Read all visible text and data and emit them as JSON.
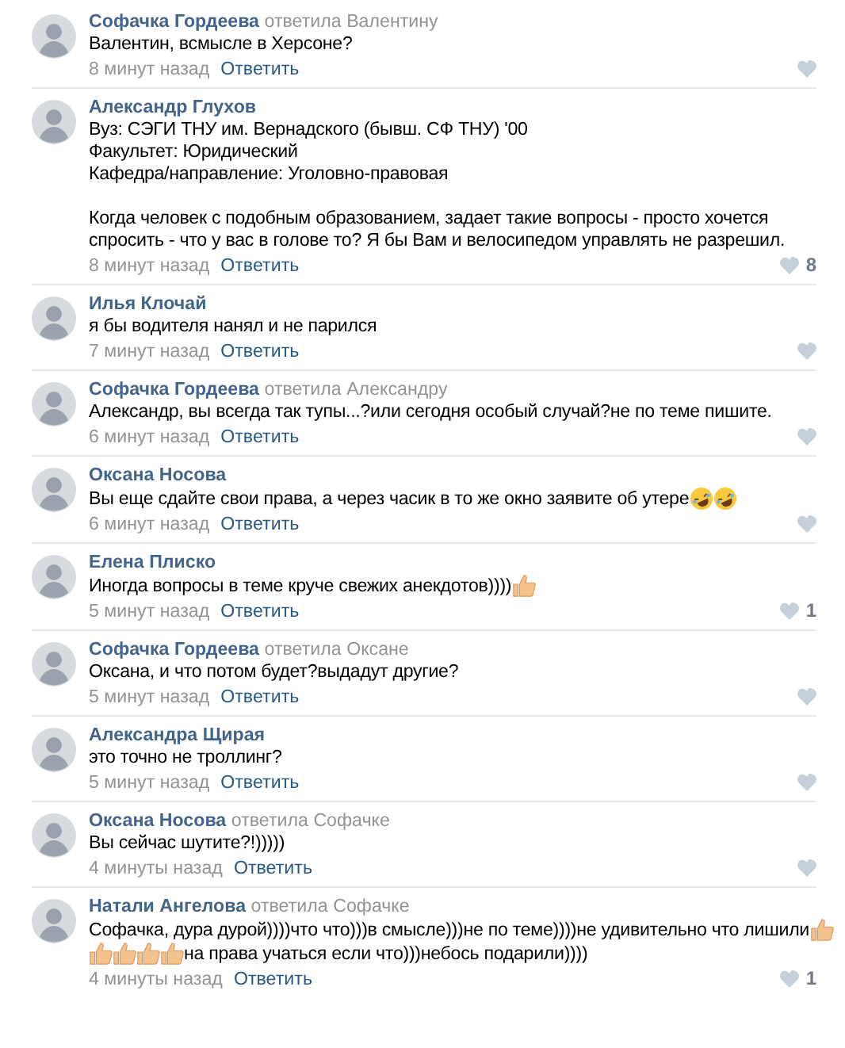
{
  "comments": [
    {
      "author": "Софачка Гордеева",
      "reply_to": "ответила Валентину",
      "paragraphs": [
        [
          [
            {
              "kind": "text",
              "text": "Валентин, всмысле в Херсоне?"
            }
          ]
        ]
      ],
      "time": "8 минут назад",
      "reply": "Ответить"
    },
    {
      "author": "Александр Глухов",
      "paragraphs": [
        [
          [
            {
              "kind": "text",
              "text": "Вуз: СЭГИ ТНУ им. Вернадского (бывш. СФ ТНУ) '00"
            }
          ],
          [
            {
              "kind": "text",
              "text": "Факультет: Юридический"
            }
          ],
          [
            {
              "kind": "text",
              "text": "Кафедра/направление: Уголовно-правовая"
            }
          ]
        ],
        [
          [
            {
              "kind": "text",
              "text": "Когда человек с подобным образованием, задает такие вопросы - просто хочется"
            }
          ],
          [
            {
              "kind": "text",
              "text": "спросить - что у вас в голове то? Я бы Вам и велосипедом управлять не разрешил."
            }
          ]
        ]
      ],
      "time": "8 минут назад",
      "reply": "Ответить",
      "likes": "8"
    },
    {
      "author": "Илья Клочай",
      "paragraphs": [
        [
          [
            {
              "kind": "text",
              "text": "я бы водителя нанял и не парился"
            }
          ]
        ]
      ],
      "time": "7 минут назад",
      "reply": "Ответить"
    },
    {
      "author": "Софачка Гордеева",
      "reply_to": "ответила Александру",
      "paragraphs": [
        [
          [
            {
              "kind": "text",
              "text": "Александр, вы всегда так тупы...?или сегодня особый случай?не по теме пишите."
            }
          ]
        ]
      ],
      "time": "6 минут назад",
      "reply": "Ответить"
    },
    {
      "author": "Оксана Носова",
      "paragraphs": [
        [
          [
            {
              "kind": "text",
              "text": "Вы еще сдайте свои права, а через часик в то же окно заявите об утере"
            },
            {
              "kind": "rofl"
            },
            {
              "kind": "rofl"
            }
          ]
        ]
      ],
      "time": "6 минут назад",
      "reply": "Ответить"
    },
    {
      "author": "Елена Плиско",
      "paragraphs": [
        [
          [
            {
              "kind": "text",
              "text": "Иногда вопросы в теме круче свежих анекдотов)))) "
            },
            {
              "kind": "thumbs_up"
            }
          ]
        ]
      ],
      "time": "5 минут назад",
      "reply": "Ответить",
      "likes": "1"
    },
    {
      "author": "Софачка Гордеева",
      "reply_to": "ответила Оксане",
      "paragraphs": [
        [
          [
            {
              "kind": "text",
              "text": "Оксана, и что потом будет?выдадут другие?"
            }
          ]
        ]
      ],
      "time": "5 минут назад",
      "reply": "Ответить"
    },
    {
      "author": "Александра Щирая",
      "paragraphs": [
        [
          [
            {
              "kind": "text",
              "text": "это точно не троллинг?"
            }
          ]
        ]
      ],
      "time": "5 минут назад",
      "reply": "Ответить"
    },
    {
      "author": "Оксана Носова",
      "reply_to": "ответила Софачке",
      "paragraphs": [
        [
          [
            {
              "kind": "text",
              "text": "Вы сейчас шутите?!)))))"
            }
          ]
        ]
      ],
      "time": "4 минуты назад",
      "reply": "Ответить"
    },
    {
      "author": "Натали Ангелова",
      "reply_to": "ответила Софачке",
      "paragraphs": [
        [
          [
            {
              "kind": "text",
              "text": "Софачка, дура дурой))))что что)))в смысле)))не по теме))))не удивительно что лишили"
            },
            {
              "kind": "thumbs_up"
            }
          ],
          [
            {
              "kind": "thumbs_up"
            },
            {
              "kind": "thumbs_up"
            },
            {
              "kind": "thumbs_up"
            },
            {
              "kind": "thumbs_up"
            },
            {
              "kind": "text",
              "text": "на права учаться если что)))небось подарили))))"
            }
          ]
        ]
      ],
      "time": "4 минуты назад",
      "reply": "Ответить",
      "likes": "1"
    }
  ]
}
